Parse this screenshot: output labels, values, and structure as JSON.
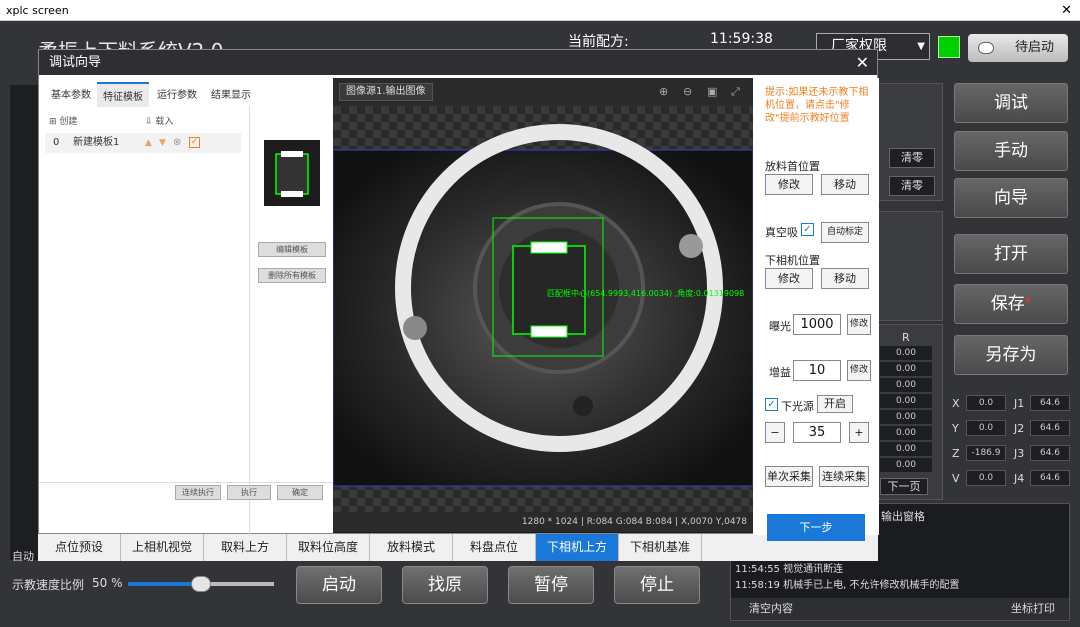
{
  "window": {
    "title": "xplc screen",
    "close": "✕"
  },
  "app": {
    "title": "柔振上下料系统V2.0",
    "recipe_label": "当前配方:",
    "time": "11:59:38",
    "permission": "厂家权限",
    "status_button": "待启动"
  },
  "right_buttons": [
    "调试",
    "手动",
    "向导",
    "打开",
    "保存",
    "另存为"
  ],
  "save_star": "*",
  "mid_buttons": [
    "清零",
    "清零"
  ],
  "r_column": {
    "header": "R",
    "values": [
      "0.00",
      "0.00",
      "0.00",
      "0.00",
      "0.00",
      "0.00",
      "0.00",
      "0.00"
    ],
    "next_page": "下一页"
  },
  "coords": [
    {
      "label": "X",
      "value": "0.0",
      "jlabel": "J1",
      "jvalue": "64.6"
    },
    {
      "label": "Y",
      "value": "0.0",
      "jlabel": "J2",
      "jvalue": "64.6"
    },
    {
      "label": "Z",
      "value": "-186.9",
      "jlabel": "J3",
      "jvalue": "64.6"
    },
    {
      "label": "V",
      "value": "0.0",
      "jlabel": "J4",
      "jvalue": "64.6"
    }
  ],
  "log": {
    "title": "输出窗格",
    "lines": [
      "11:54:55  视觉通讯断连",
      "11:58:19  机械手已上电, 不允许修改机械手的配置"
    ],
    "clear": "清空内容",
    "print": "坐标打印"
  },
  "auto_label": "自动",
  "speed": {
    "label": "示教速度比例",
    "value": "50",
    "unit": "%",
    "percent": 50
  },
  "big_buttons": [
    "启动",
    "找原",
    "暂停",
    "停止"
  ],
  "bottom_tabs": [
    "点位预设",
    "上相机视觉",
    "取料上方",
    "取料位高度",
    "放料模式",
    "料盘点位",
    "下相机上方",
    "下相机基准"
  ],
  "active_tab": "下相机上方",
  "dialog": {
    "title": "调试向导",
    "close": "✕",
    "subtabs": [
      "基本参数",
      "特征模板",
      "运行参数",
      "结果显示"
    ],
    "create": "创建",
    "load": "载入",
    "template_index": "0",
    "template_name": "新建模板1",
    "edit_template": "编辑模板",
    "delete_all": "删除所有模板",
    "footer_buttons": [
      "连续执行",
      "执行",
      "确定"
    ],
    "image_source": "图像源1.输出图像",
    "match_text": "匹配框中心(654.9993,416.0034) ,角度:0.01319098",
    "image_info": "1280 * 1024  |  R:084  G:084  B:084  |  X,0070  Y,0478",
    "hint": "提示:如果还未示教下相机位置，请点击\"修改\"提前示教好位置",
    "place_first": "放料首位置",
    "modify": "修改",
    "move": "移动",
    "vacuum": "真空吸",
    "auto_calib": "自动标定",
    "lower_cam_pos": "下相机位置",
    "exposure_label": "曝光",
    "exposure_value": "1000",
    "gain_label": "增益",
    "gain_value": "10",
    "light_label": "下光源",
    "light_on": "开启",
    "light_value": "35",
    "minus": "−",
    "plus": "+",
    "single_capture": "单次采集",
    "continuous_capture": "连续采集",
    "next_step": "下一步"
  }
}
